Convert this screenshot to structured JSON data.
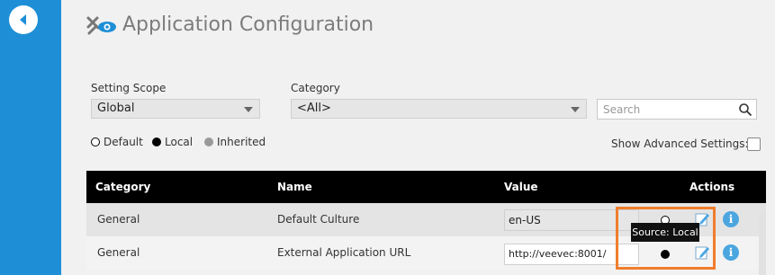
{
  "header": {
    "title": "Application Configuration"
  },
  "filters": {
    "scope_label": "Setting Scope",
    "scope_value": "Global",
    "category_label": "Category",
    "category_value": "<All>",
    "search_placeholder": "Search"
  },
  "legend": {
    "default": "Default",
    "local": "Local",
    "inherited": "Inherited"
  },
  "advanced": {
    "label": "Show Advanced Settings:",
    "checked": false
  },
  "table": {
    "headers": [
      "Category",
      "Name",
      "Value",
      "Actions"
    ],
    "rows": [
      {
        "category": "General",
        "name": "Default Culture",
        "value": "en-US"
      },
      {
        "category": "General",
        "name": "External Application URL",
        "value": "http://veevec:8001/"
      }
    ]
  },
  "tooltip": {
    "text": "Source: Local"
  },
  "colors": {
    "sidebar": "#1e8fd6",
    "accent": "#4ba6e0",
    "highlight": "#f07d2c",
    "header_bg": "#000000"
  },
  "icons": {
    "back": "back-arrow-icon",
    "title": "tools-eye-icon",
    "search": "search-icon",
    "edit": "edit-pencil-icon",
    "info": "info-icon"
  }
}
